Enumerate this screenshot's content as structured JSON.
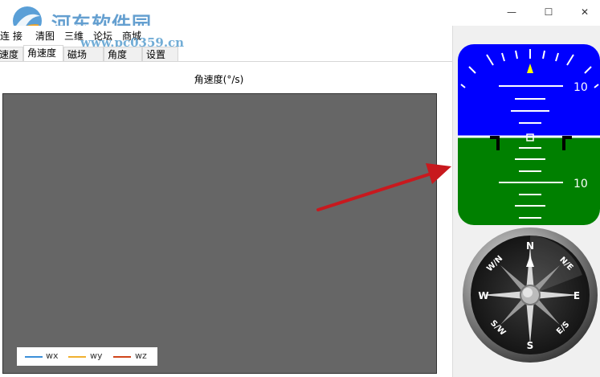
{
  "window": {
    "watermark_title": "河东软件园",
    "watermark_url": "www.pc0359.cn",
    "minimize_glyph": "—",
    "maximize_glyph": "☐",
    "close_glyph": "✕"
  },
  "menu": {
    "items": [
      "连  接",
      "清图",
      "三维",
      "论坛",
      "商城"
    ]
  },
  "tabs": [
    {
      "label": "加速度"
    },
    {
      "label": "角速度"
    },
    {
      "label": "磁场"
    },
    {
      "label": "角度"
    },
    {
      "label": "设置"
    }
  ],
  "chart": {
    "title": "角速度(°/s)",
    "legend": [
      {
        "name": "wx",
        "color": "#3b8fd9"
      },
      {
        "name": "wy",
        "color": "#f0b030"
      },
      {
        "name": "wz",
        "color": "#d0451b"
      }
    ]
  },
  "chart_data": {
    "type": "line",
    "title": "角速度(°/s)",
    "series": [
      {
        "name": "wx",
        "values": []
      },
      {
        "name": "wy",
        "values": []
      },
      {
        "name": "wz",
        "values": []
      }
    ],
    "grid": false,
    "legend_position": "bottom-left",
    "background": "#666666"
  },
  "attitude": {
    "pitch_label_top": "10",
    "pitch_label_bottom": "10",
    "sky_color": "#0000ff",
    "ground_color": "#008000"
  },
  "compass": {
    "n": "N",
    "ne": "N/E",
    "e": "E",
    "se": "E/S",
    "s": "S",
    "sw": "S/W",
    "w": "W",
    "nw": "W/N"
  }
}
